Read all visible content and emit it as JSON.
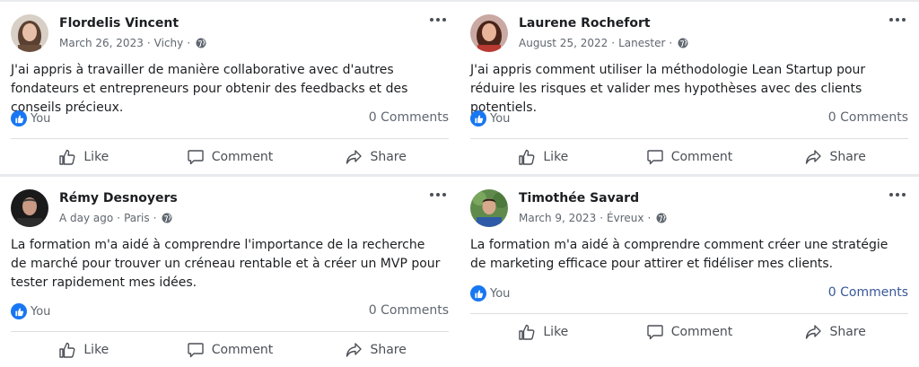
{
  "colors": {
    "accent": "#1877f2",
    "text": "#1c1e21",
    "muted": "#606770",
    "link": "#385898"
  },
  "posts": [
    {
      "author": "Flordelis Vincent",
      "date": "March 26, 2023",
      "location": "Vichy",
      "text": "J'ai appris à travailler de manière collaborative avec d'autres fondateurs et entrepreneurs pour obtenir des feedbacks et des conseils précieux.",
      "reaction_label": "You",
      "comments": "0 Comments",
      "actions": {
        "like": "Like",
        "comment": "Comment",
        "share": "Share"
      }
    },
    {
      "author": "Laurene Rochefort",
      "date": "August 25, 2022",
      "location": "Lanester",
      "text": "J'ai appris comment utiliser la méthodologie Lean Startup pour réduire les risques et valider mes hypothèses avec des clients potentiels.",
      "reaction_label": "You",
      "comments": "0 Comments",
      "actions": {
        "like": "Like",
        "comment": "Comment",
        "share": "Share"
      }
    },
    {
      "author": "Rémy Desnoyers",
      "date": "A day ago",
      "location": "Paris",
      "text": "La formation m'a aidé à comprendre l'importance de la recherche de marché pour trouver un créneau rentable et à créer un MVP pour tester rapidement mes idées.",
      "reaction_label": "You",
      "comments": "0 Comments",
      "actions": {
        "like": "Like",
        "comment": "Comment",
        "share": "Share"
      }
    },
    {
      "author": "Timothée Savard",
      "date": "March 9, 2023",
      "location": "Évreux",
      "text": "La formation m'a aidé à comprendre comment créer une stratégie de marketing efficace pour attirer et fidéliser mes clients.",
      "reaction_label": "You",
      "comments": "0 Comments",
      "actions": {
        "like": "Like",
        "comment": "Comment",
        "share": "Share"
      }
    }
  ]
}
